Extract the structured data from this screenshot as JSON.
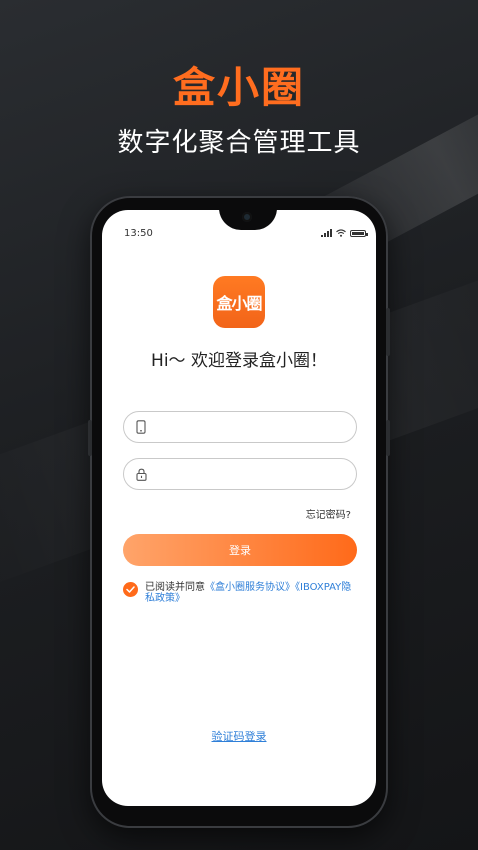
{
  "banner": {
    "brand": "盒小圈",
    "slogan": "数字化聚合管理工具"
  },
  "status_bar": {
    "time": "13:50"
  },
  "app": {
    "logo_text": "盒小圈",
    "welcome": "Hi～ 欢迎登录盒小圈！"
  },
  "form": {
    "phone_value": "",
    "password_value": "",
    "forgot_password": "忘记密码?",
    "login_button": "登录"
  },
  "agreement": {
    "prefix": "已阅读并同意",
    "service_agreement": "《盒小圈服务协议》",
    "privacy_policy": "《IBOXPAY隐私政策》",
    "checked": true
  },
  "sms_login": "验证码登录",
  "colors": {
    "brand_orange": "#ff6d1f",
    "link_blue": "#2f7fd8"
  },
  "icons": {
    "phone_field": "mobile-phone-icon",
    "password_field": "lock-icon",
    "agreement_check": "checkmark-icon"
  }
}
